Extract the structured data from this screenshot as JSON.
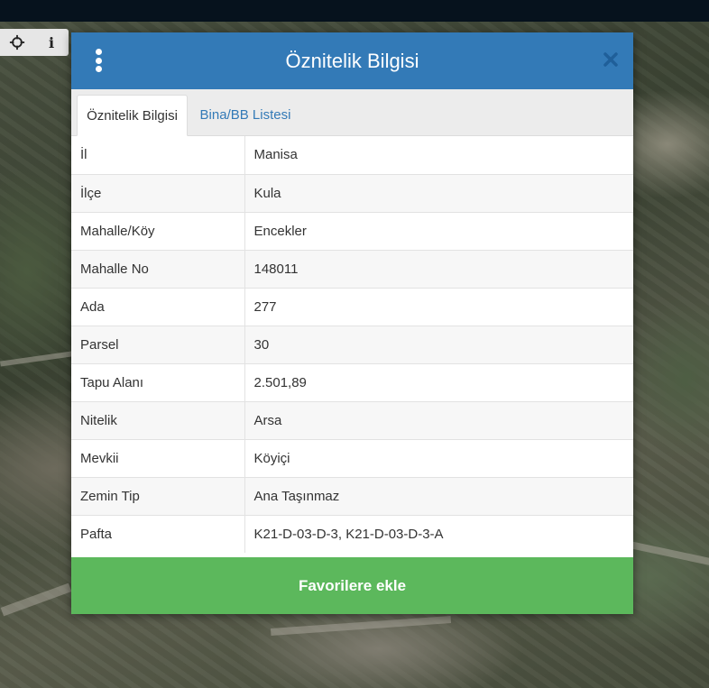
{
  "modal": {
    "title": "Öznitelik Bilgisi",
    "tabs": [
      {
        "label": "Öznitelik Bilgisi",
        "active": true
      },
      {
        "label": "Bina/BB Listesi",
        "active": false
      }
    ],
    "rows": [
      {
        "key": "İl",
        "value": "Manisa"
      },
      {
        "key": "İlçe",
        "value": "Kula"
      },
      {
        "key": "Mahalle/Köy",
        "value": "Encekler"
      },
      {
        "key": "Mahalle No",
        "value": "148011"
      },
      {
        "key": "Ada",
        "value": "277"
      },
      {
        "key": "Parsel",
        "value": "30"
      },
      {
        "key": "Tapu Alanı",
        "value": "2.501,89"
      },
      {
        "key": "Nitelik",
        "value": "Arsa"
      },
      {
        "key": "Mevkii",
        "value": "Köyiçi"
      },
      {
        "key": "Zemin Tip",
        "value": "Ana Taşınmaz"
      },
      {
        "key": "Pafta",
        "value": "K21-D-03-D-3, K21-D-03-D-3-A"
      }
    ],
    "favorite_label": "Favorilere ekle"
  },
  "map_tools": {
    "info_glyph": "i"
  },
  "icons": {
    "menu": "vertical-dots-icon",
    "close": "close-icon",
    "locate": "crosshair-icon",
    "info": "info-icon"
  },
  "colors": {
    "header": "#337ab7",
    "favorite": "#5cb85c",
    "tab_link": "#337ab7"
  }
}
